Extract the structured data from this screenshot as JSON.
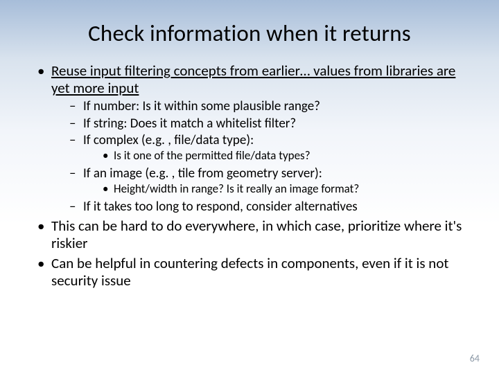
{
  "title": "Check information when it returns",
  "bullets": {
    "b1_a": "Reuse input filtering concepts from earlier… values from libraries are yet more input",
    "b1_sub": {
      "s1": "If number: Is it within some plausible range?",
      "s2": "If string: Does it match a whitelist filter?",
      "s3": "If complex (e.g. , file/data type):",
      "s3_sub": {
        "t1": "Is it one of the permitted file/data types?"
      },
      "s4": "If an image (e.g. , tile from geometry server):",
      "s4_sub": {
        "t1": "Height/width in range? Is it really an image format?"
      },
      "s5": "If it takes too long to respond, consider alternatives"
    },
    "b2": "This can be hard to do everywhere, in which case, prioritize where it's riskier",
    "b3": "Can be helpful in countering defects in components, even if it is not security issue"
  },
  "page_number": "64"
}
